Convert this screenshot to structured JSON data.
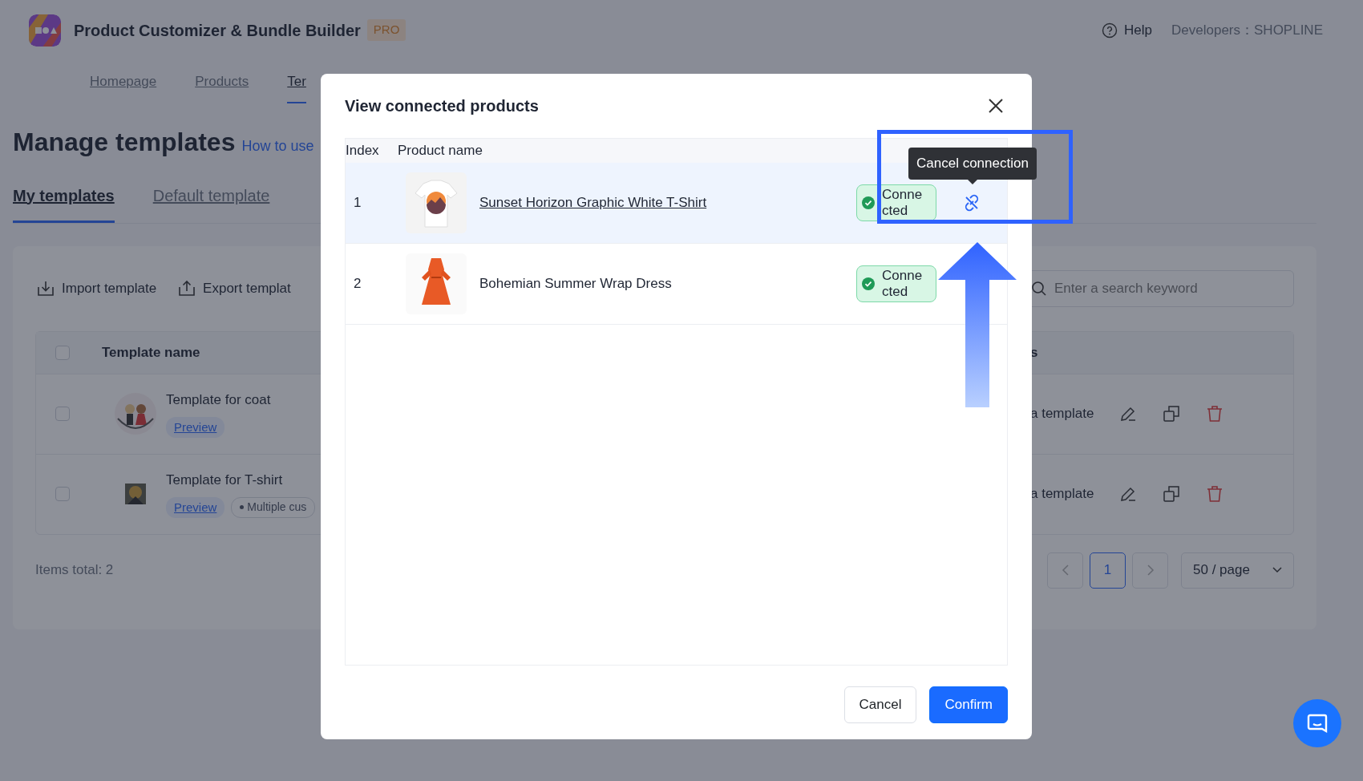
{
  "app": {
    "title": "Product Customizer & Bundle Builder",
    "badge": "PRO",
    "help": "Help",
    "developer": "Developers：SHOPLINE"
  },
  "nav": [
    {
      "label": "Homepage",
      "selected": false
    },
    {
      "label": "Products",
      "selected": false
    },
    {
      "label": "Ter",
      "selected": true
    }
  ],
  "page": {
    "title": "Manage templates",
    "help_link": "How to use"
  },
  "tabs": [
    {
      "label": "My templates",
      "selected": true
    },
    {
      "label": "Default template",
      "selected": false
    }
  ],
  "toolbar": {
    "actions": [
      {
        "label": "Import template",
        "kind": "import"
      },
      {
        "label": "Export templat",
        "kind": "export"
      }
    ],
    "search": {
      "placeholder": "Enter a search keyword"
    }
  },
  "templates": {
    "columns": [
      "Template name",
      "s"
    ],
    "all_checked": false,
    "rows": [
      {
        "name": "Template for coat",
        "checked": false,
        "tags": [
          {
            "label": "Preview",
            "kind": "preview"
          }
        ],
        "column_2": "a template"
      },
      {
        "name": "Template for T-shirt",
        "checked": false,
        "tags": [
          {
            "label": "Preview",
            "kind": "preview"
          },
          {
            "label": "Multiple cus",
            "kind": "chip"
          }
        ],
        "column_2": "a template"
      }
    ]
  },
  "footer": {
    "total": "Items total: 2",
    "pages": [
      {
        "label": "1",
        "selected": true
      }
    ],
    "page_size": "50 / page"
  },
  "dialog": {
    "title": "View connected products",
    "columns": [
      "Index",
      "Product name"
    ],
    "rows": [
      {
        "index": "1",
        "name": "Sunset Horizon Graphic White T-Shirt",
        "status": "Connected",
        "hovered": true,
        "kind": "shirt"
      },
      {
        "index": "2",
        "name": "Bohemian Summer Wrap Dress",
        "status": "Connected",
        "hovered": false,
        "kind": "dress"
      }
    ],
    "tooltip": "Cancel connection",
    "buttons": [
      {
        "label": "Cancel",
        "kind": "secondary"
      },
      {
        "label": "Confirm",
        "kind": "primary"
      }
    ]
  }
}
